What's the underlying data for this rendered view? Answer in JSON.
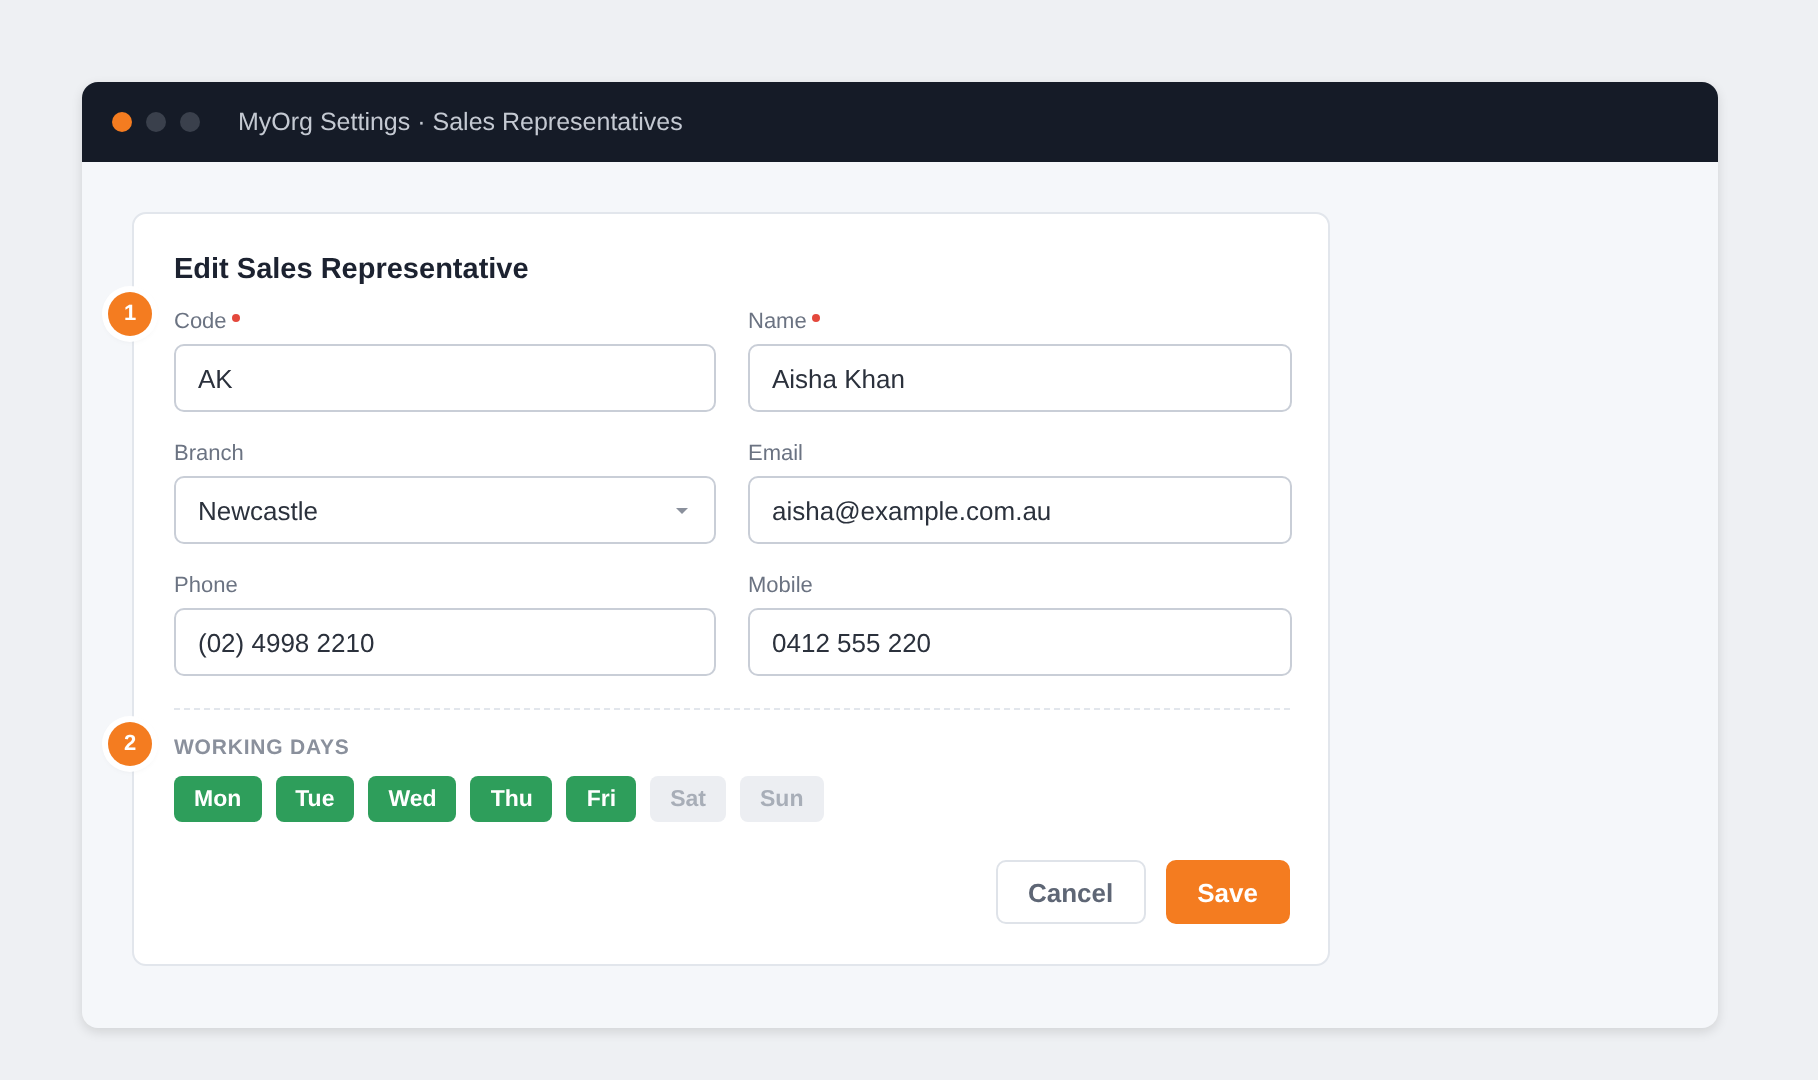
{
  "window": {
    "title": "MyOrg Settings · Sales Representatives"
  },
  "form": {
    "title": "Edit Sales Representative",
    "fields": [
      {
        "label": "Code",
        "required": true,
        "kind": "text",
        "value": "AK"
      },
      {
        "label": "Name",
        "required": true,
        "kind": "text",
        "value": "Aisha Khan"
      },
      {
        "label": "Branch",
        "required": false,
        "kind": "select",
        "value": "Newcastle"
      },
      {
        "label": "Email",
        "required": false,
        "kind": "text",
        "value": "aisha@example.com.au"
      },
      {
        "label": "Phone",
        "required": false,
        "kind": "text",
        "value": "(02) 4998 2210"
      },
      {
        "label": "Mobile",
        "required": false,
        "kind": "text",
        "value": "0412 555 220"
      }
    ],
    "working_days": {
      "label": "WORKING DAYS",
      "days": [
        {
          "label": "Mon",
          "selected": true
        },
        {
          "label": "Tue",
          "selected": true
        },
        {
          "label": "Wed",
          "selected": true
        },
        {
          "label": "Thu",
          "selected": true
        },
        {
          "label": "Fri",
          "selected": true
        },
        {
          "label": "Sat",
          "selected": false
        },
        {
          "label": "Sun",
          "selected": false
        }
      ]
    },
    "buttons": [
      {
        "label": "Cancel",
        "kind": "secondary"
      },
      {
        "label": "Save",
        "kind": "primary"
      }
    ]
  },
  "markers": [
    "1",
    "2"
  ]
}
